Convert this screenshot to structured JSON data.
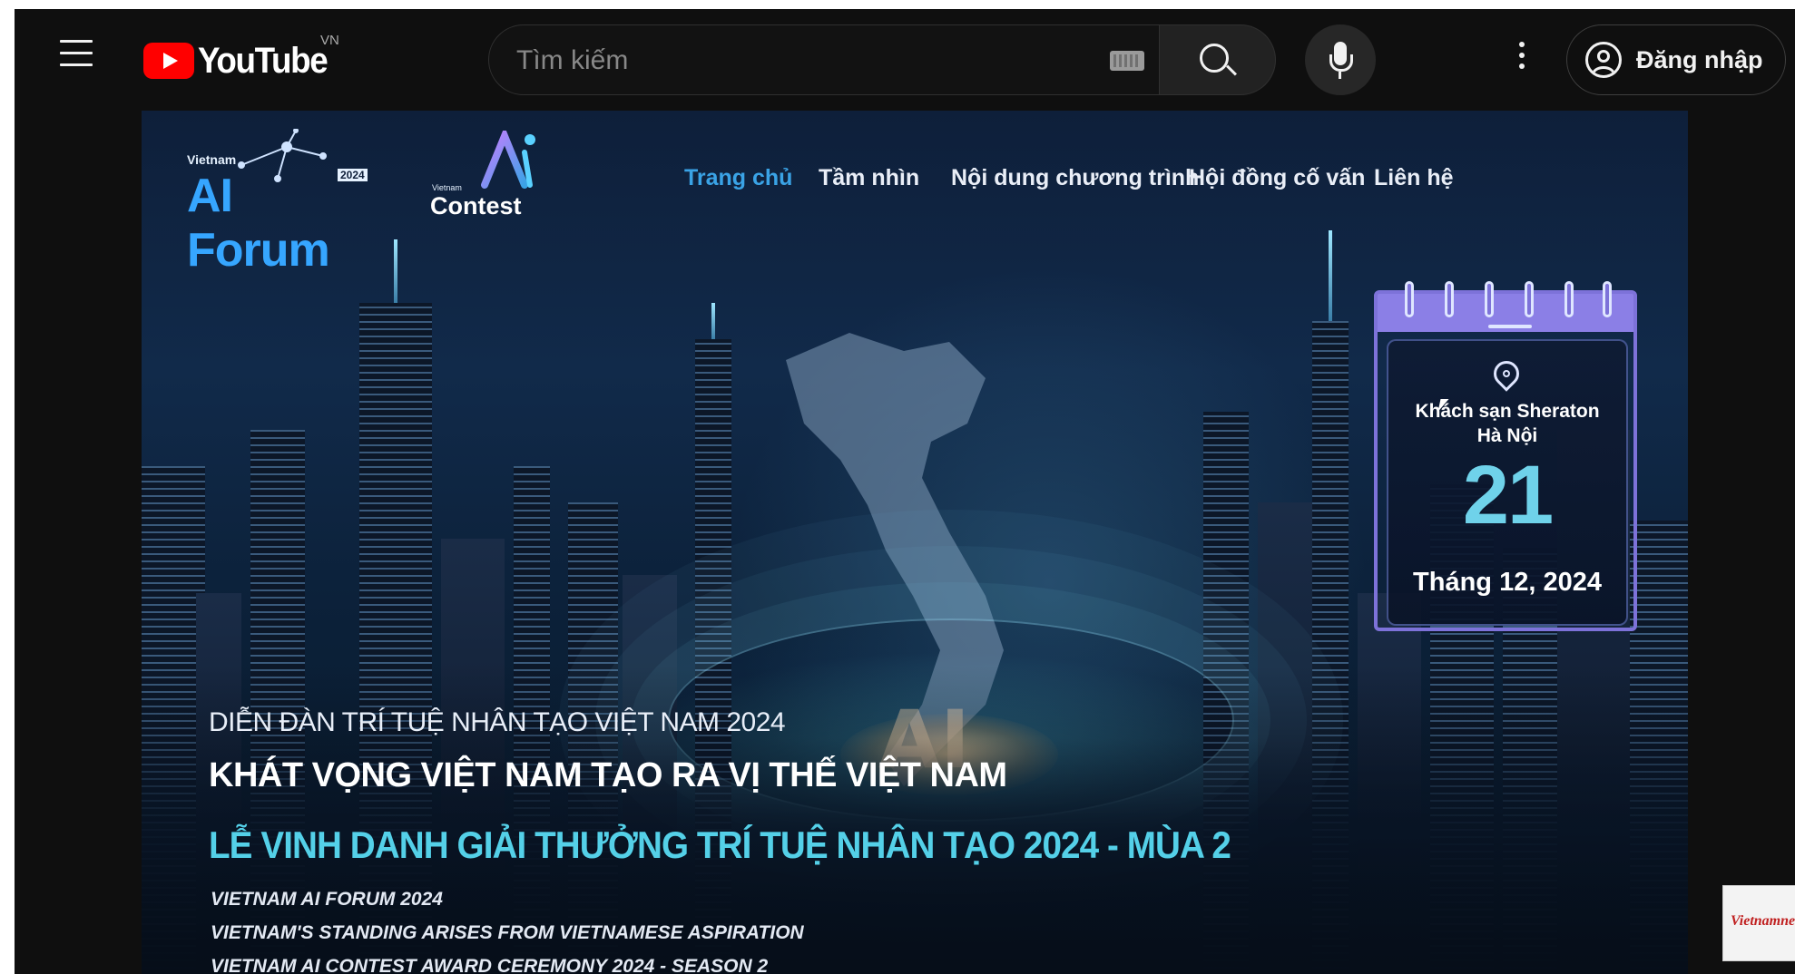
{
  "header": {
    "logo_text": "YouTube",
    "country_code": "VN",
    "search": {
      "placeholder": "Tìm kiếm",
      "value": ""
    },
    "sign_in_label": "Đăng nhập",
    "icons": [
      "menu-icon",
      "keyboard-icon",
      "search-icon",
      "microphone-icon",
      "more-vert-icon",
      "account-icon"
    ]
  },
  "video": {
    "site_logos": {
      "ai_forum_small": "Vietnam",
      "ai_forum_main": "AI Forum",
      "ai_forum_year": "2024",
      "contest_small": "Vietnam",
      "contest_word": "Contest"
    },
    "site_nav": [
      {
        "label": "Trang chủ",
        "active": true
      },
      {
        "label": "Tầm nhìn",
        "active": false
      },
      {
        "label": "Nội dung chương trình",
        "active": false
      },
      {
        "label": "Hội đồng cố vấn",
        "active": false
      },
      {
        "label": "Liên hệ",
        "active": false
      }
    ],
    "calendar": {
      "venue_line1": "Khách sạn Sheraton",
      "venue_line2": "Hà Nội",
      "day": "21",
      "month_year": "Tháng 12, 2024"
    },
    "headline_1": "DIỄN ĐÀN TRÍ TUỆ NHÂN TẠO VIỆT NAM 2024",
    "headline_2": "KHÁT VỌNG VIỆT NAM TẠO RA VỊ THẾ VIỆT NAM",
    "headline_3": "LỄ VINH DANH GIẢI THƯỞNG TRÍ TUỆ NHÂN TẠO 2024 - MÙA 2",
    "subtitles": [
      "VIETNAM AI FORUM 2024",
      "VIETNAM'S STANDING ARISES FROM VIETNAMESE ASPIRATION",
      "VIETNAM AI CONTEST AWARD CEREMONY 2024 - SEASON 2"
    ],
    "background_glyph": "AI"
  },
  "watermark": {
    "text": "Vietnamnet"
  },
  "colors": {
    "youtube_red": "#ff0000",
    "nav_active": "#3aa3e6",
    "headline_accent": "#54d0e8",
    "calendar_frame": "#7d72d9"
  }
}
